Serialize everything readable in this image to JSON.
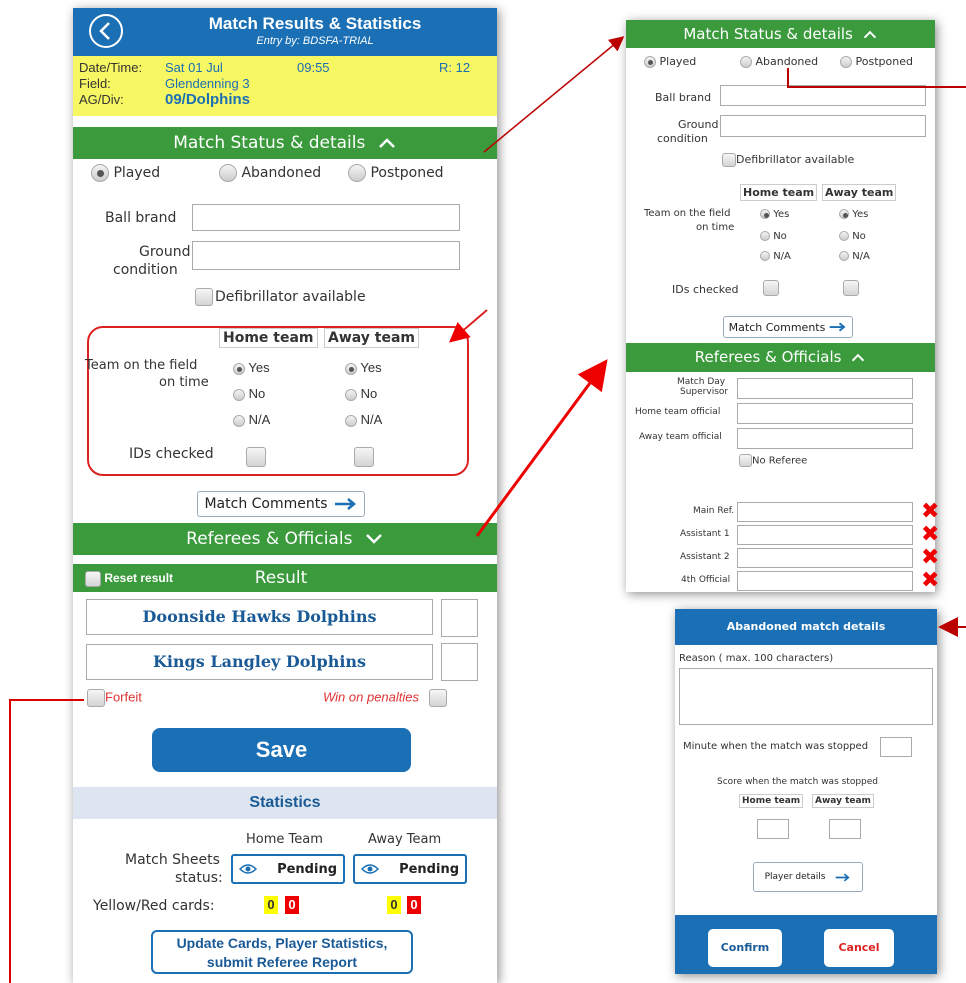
{
  "main": {
    "header": {
      "title": "Match Results & Statistics",
      "subtitle": "Entry by: BDSFA-TRIAL"
    },
    "info": {
      "date_label": "Date/Time:",
      "date_value": "Sat 01 Jul",
      "time_value": "09:55",
      "round": "R: 12",
      "field_label": "Field:",
      "field_value": "Glendenning 3",
      "div_label": "AG/Div:",
      "div_value": "09/Dolphins"
    },
    "status_section": {
      "title": "Match Status & details",
      "chevron": "chevron-up-icon"
    },
    "status_options": [
      "Played",
      "Abandoned",
      "Postponed"
    ],
    "ball_brand_label": "Ball brand",
    "ground_label_1": "Ground",
    "ground_label_2": "condition",
    "defib_label": "Defibrillator available",
    "home_team_label": "Home team",
    "away_team_label": "Away team",
    "on_time_label_1": "Team on the field",
    "on_time_label_2": "on time",
    "yes": "Yes",
    "no": "No",
    "na": "N/A",
    "ids_label": "IDs checked",
    "match_comments": "Match Comments",
    "referees_section": {
      "title": "Referees & Officials",
      "chevron": "chevron-down-icon"
    },
    "reset_result": "Reset result",
    "result_title": "Result",
    "home_team": "Doonside Hawks Dolphins",
    "away_team": "Kings Langley Dolphins",
    "forfeit": "Forfeit",
    "win_penalties": "Win on penalties",
    "save": "Save",
    "statistics": "Statistics",
    "stats_home": "Home Team",
    "stats_away": "Away Team",
    "match_sheets_1": "Match Sheets",
    "match_sheets_2": "status:",
    "pending": "Pending",
    "cards_label": "Yellow/Red cards:",
    "home_yellow": "0",
    "home_red": "0",
    "away_yellow": "0",
    "away_red": "0",
    "update_btn_1": "Update Cards, Player Statistics,",
    "update_btn_2": "submit Referee Report"
  },
  "zoom1": {
    "title": "Match Status & details",
    "status_options": [
      "Played",
      "Abandoned",
      "Postponed"
    ],
    "ball_brand_label": "Ball brand",
    "ground_label_1": "Ground",
    "ground_label_2": "condition",
    "defib_label": "Defibrillator available",
    "home_team_label": "Home team",
    "away_team_label": "Away team",
    "on_time_label_1": "Team on the field",
    "on_time_label_2": "on time",
    "yes": "Yes",
    "no": "No",
    "na": "N/A",
    "ids_label": "IDs checked",
    "match_comments": "Match Comments",
    "ref_title": "Referees & Officials",
    "supervisor_1": "Match Day",
    "supervisor_2": "Supervisor",
    "home_official": "Home team official",
    "away_official": "Away team official",
    "no_referee": "No Referee",
    "main_ref": "Main Ref.",
    "assistant1": "Assistant 1",
    "assistant2": "Assistant 2",
    "fourth": "4th Official"
  },
  "dialog": {
    "title": "Abandoned match details",
    "reason_label": "Reason ( max. 100 characters)",
    "minute_label": "Minute when the match was stopped",
    "score_label": "Score when the match was stopped",
    "home_team_label": "Home team",
    "away_team_label": "Away team",
    "player_details": "Player details",
    "confirm": "Confirm",
    "cancel": "Cancel"
  },
  "colors": {
    "brand_blue": "#1a6fb5",
    "green": "#3a9a3c",
    "info_yellow": "#f7f763",
    "annotation_red": "#e00000"
  }
}
